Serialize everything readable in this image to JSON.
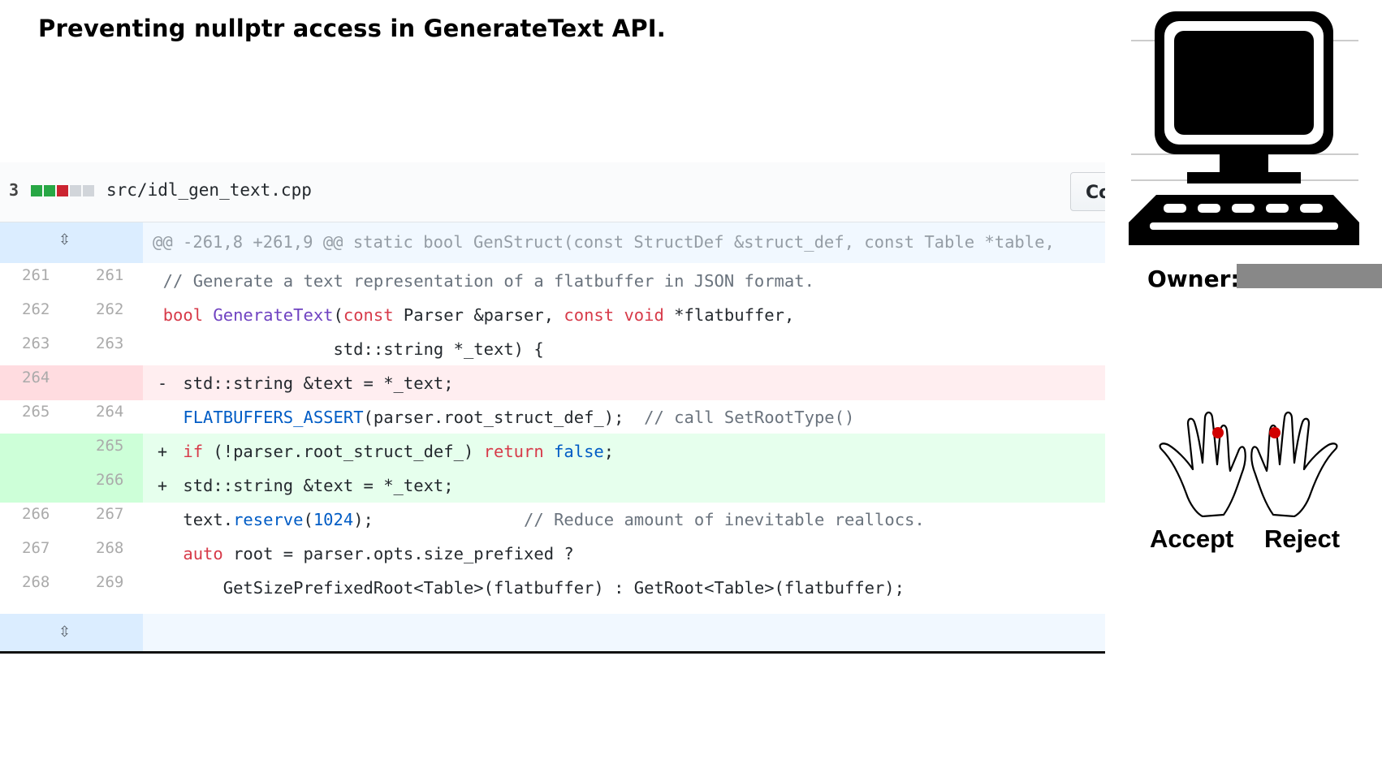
{
  "title": "Preventing nullptr access in GenerateText API.",
  "file": {
    "changes": "3",
    "path": "src/idl_gen_text.cpp",
    "view_button": "Co",
    "stat_colors": [
      "#28a745",
      "#28a745",
      "#cb2431",
      "#d1d5da",
      "#d1d5da"
    ]
  },
  "hunk_header": "@@ -261,8 +261,9 @@ static bool GenStruct(const StructDef &struct_def, const Table *table,",
  "lines": [
    {
      "old": "261",
      "new": "261",
      "type": "ctx",
      "marker": "",
      "code": "  // Generate a text representation of a flatbuffer in JSON format."
    },
    {
      "old": "262",
      "new": "262",
      "type": "ctx",
      "marker": "",
      "code": "  bool GenerateText(const Parser &parser, const void *flatbuffer,"
    },
    {
      "old": "263",
      "new": "263",
      "type": "ctx",
      "marker": "",
      "code": "                   std::string *_text) {"
    },
    {
      "old": "264",
      "new": "",
      "type": "del",
      "marker": "-",
      "code": "    std::string &text = *_text;"
    },
    {
      "old": "265",
      "new": "264",
      "type": "ctx",
      "marker": "",
      "code": "    FLATBUFFERS_ASSERT(parser.root_struct_def_);  // call SetRootType()"
    },
    {
      "old": "",
      "new": "265",
      "type": "add",
      "marker": "+",
      "code": "    if (!parser.root_struct_def_) return false;"
    },
    {
      "old": "",
      "new": "266",
      "type": "add",
      "marker": "+",
      "code": "    std::string &text = *_text;"
    },
    {
      "old": "266",
      "new": "267",
      "type": "ctx",
      "marker": "",
      "code": "    text.reserve(1024);               // Reduce amount of inevitable reallocs."
    },
    {
      "old": "267",
      "new": "268",
      "type": "ctx",
      "marker": "",
      "code": "    auto root = parser.opts.size_prefixed ?"
    },
    {
      "old": "268",
      "new": "269",
      "type": "ctx",
      "marker": "",
      "code": "        GetSizePrefixedRoot<Table>(flatbuffer) : GetRoot<Table>(flatbuffer);"
    }
  ],
  "owner_label": "Owner:",
  "accept_label": "Accept",
  "reject_label": "Reject"
}
